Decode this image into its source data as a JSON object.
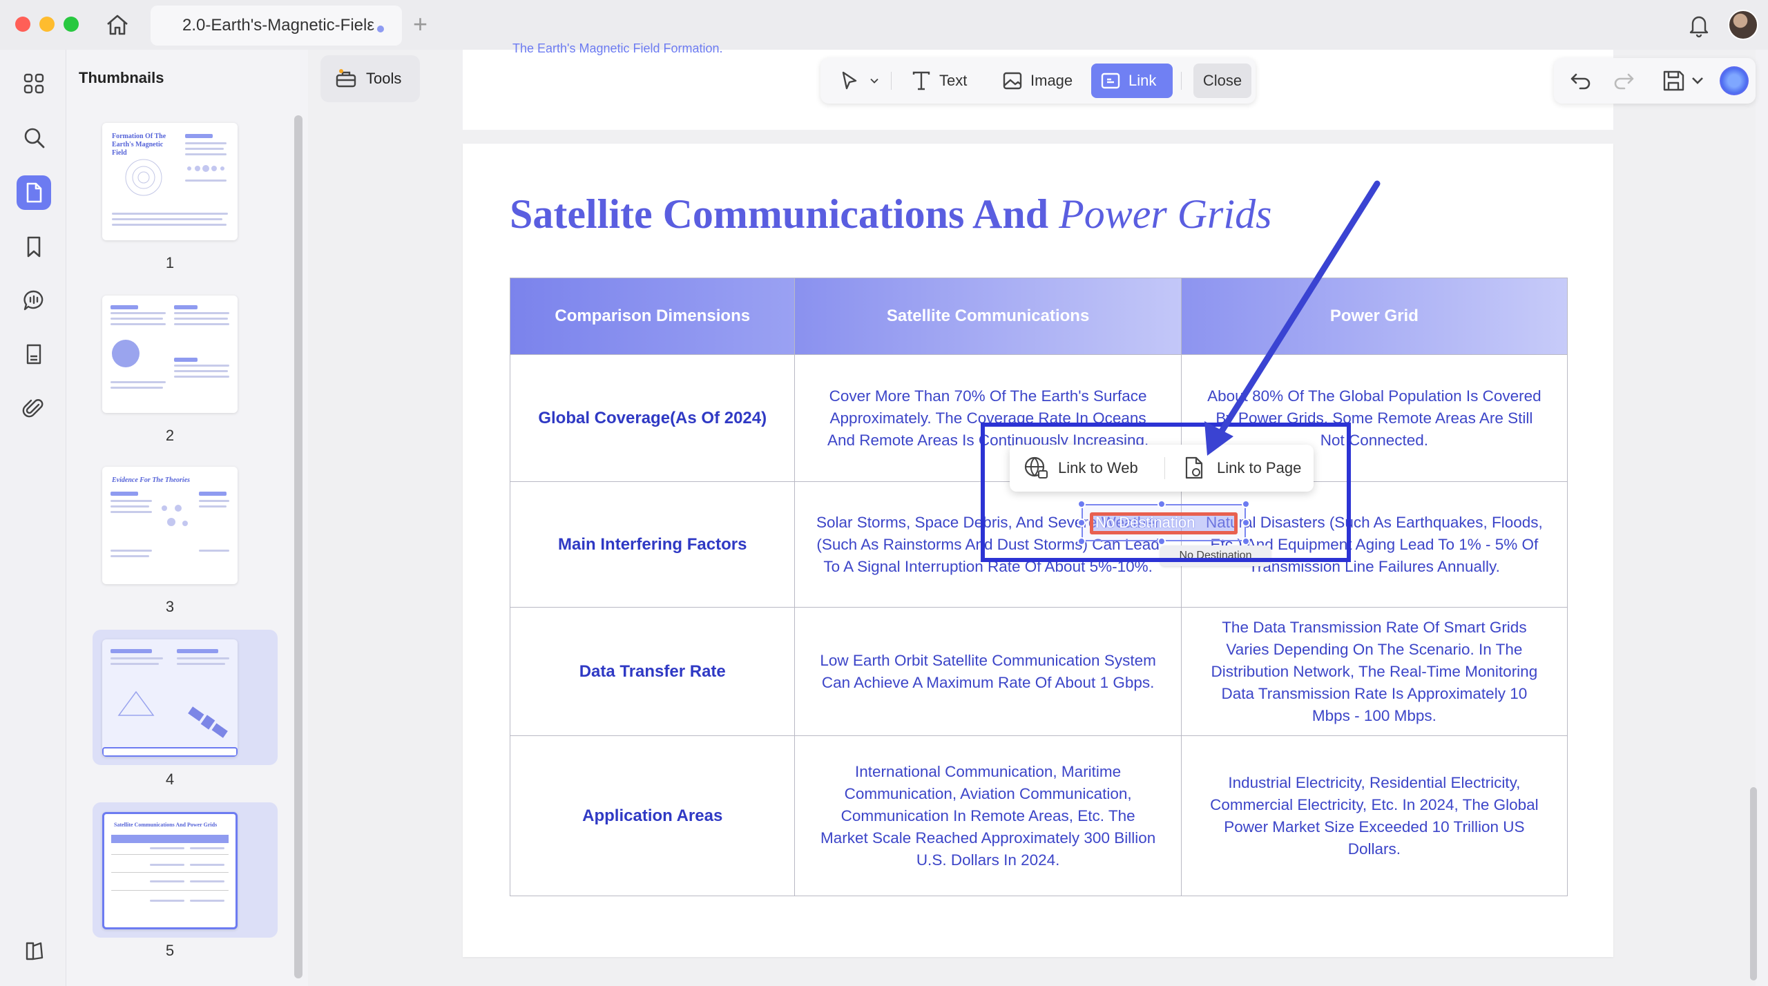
{
  "window": {
    "tab_title": "2.0-Earth's-Magnetic-Fielε",
    "tab_add": "+"
  },
  "sidebar": {
    "title": "Thumbnails",
    "tools_label": "Tools",
    "thumbnails": [
      {
        "page": "1",
        "mini_title": "Formation Of The Earth's Magnetic Field"
      },
      {
        "page": "2",
        "mini_title": ""
      },
      {
        "page": "3",
        "mini_title": "Evidence For The Theories"
      },
      {
        "page": "4",
        "mini_title": ""
      },
      {
        "page": "5",
        "mini_title": "Satellite Communications And Power Grids"
      }
    ]
  },
  "toolbar": {
    "text_label": "Text",
    "image_label": "Image",
    "link_label": "Link",
    "close_label": "Close"
  },
  "page_prev": {
    "footer_text": "The Earth's Magnetic Field Formation."
  },
  "page": {
    "heading_main": "Satellite Communications And ",
    "heading_italic": "Power Grids",
    "table": {
      "headers": [
        "Comparison Dimensions",
        "Satellite Communications",
        "Power Grid"
      ],
      "rows": [
        {
          "dimension": "Global Coverage(As Of 2024)",
          "satellite": "Cover More Than 70% Of The Earth's Surface Approximately. The Coverage Rate In Oceans And Remote Areas Is Continuously Increasing.",
          "grid": "About 80% Of The Global Population Is Covered By Power Grids. Some Remote Areas Are Still Not Connected."
        },
        {
          "dimension": "Main Interfering Factors",
          "satellite": "Solar Storms, Space Debris, And Severe Weather (Such As Rainstorms And Dust Storms) Can Lead To A Signal Interruption Rate Of About 5%-10%.",
          "grid": "Natural Disasters (Such As Earthquakes, Floods, Etc.) And Equipment Aging Lead To 1% - 5% Of Transmission Line Failures Annually."
        },
        {
          "dimension": "Data Transfer Rate",
          "satellite": "Low Earth Orbit Satellite Communication System Can Achieve A Maximum Rate Of About 1 Gbps.",
          "grid": "The Data Transmission Rate Of Smart Grids Varies Depending On The Scenario. In The Distribution Network, The Real-Time Monitoring Data Transmission Rate Is Approximately 10 Mbps - 100 Mbps."
        },
        {
          "dimension": "Application Areas",
          "satellite": "International Communication, Maritime Communication, Aviation Communication, Communication In Remote Areas, Etc. The Market Scale Reached Approximately 300 Billion U.S. Dollars In 2024.",
          "grid": "Industrial Electricity, Residential Electricity, Commercial Electricity, Etc. In 2024, The Global Power Market Size Exceeded 10 Trillion US Dollars."
        }
      ]
    }
  },
  "link_popup": {
    "web_label": "Link to Web",
    "page_label": "Link to Page",
    "selection_label": "No Destination",
    "tooltip": "No Destination"
  },
  "colors": {
    "accent": "#6c7bf1",
    "heading": "#5a5ee0",
    "table_text": "#3c45c8",
    "annotation": "#2c33d4",
    "selection_red": "#e8604f"
  }
}
